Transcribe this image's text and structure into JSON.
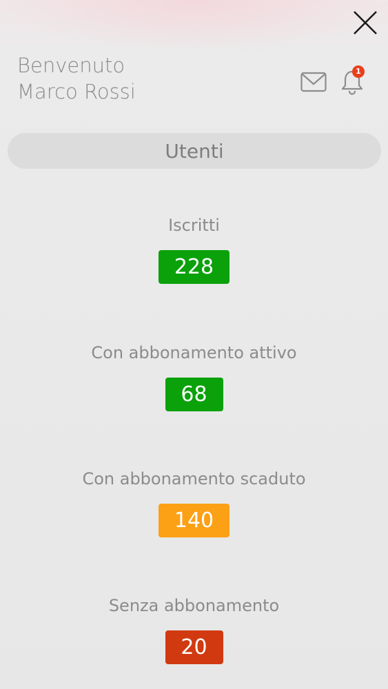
{
  "header": {
    "welcome_line1": "Benvenuto",
    "welcome_line2": "Marco Rossi",
    "notification_count": "1"
  },
  "icons": {
    "close": "close-icon",
    "mail": "mail-icon",
    "bell": "bell-icon"
  },
  "section": {
    "title": "Utenti"
  },
  "stats": [
    {
      "label": "Iscritti",
      "value": "228",
      "color": "#0ba10b"
    },
    {
      "label": "Con abbonamento attivo",
      "value": "68",
      "color": "#0ba10b"
    },
    {
      "label": "Con abbonamento scaduto",
      "value": "140",
      "color": "#fca015"
    },
    {
      "label": "Senza abbonamento",
      "value": "20",
      "color": "#d13a10"
    }
  ]
}
